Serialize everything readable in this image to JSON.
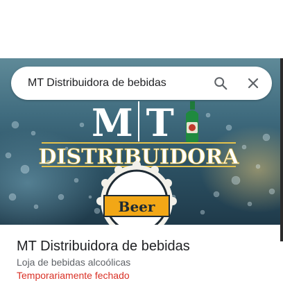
{
  "search": {
    "query": "MT Distribuidora de bebidas",
    "search_icon": "search-icon",
    "close_icon": "close-icon"
  },
  "hero": {
    "logo_monogram": "M T",
    "logo_wordmark": "DISTRIBUIDORA",
    "logo_badge": "Beer"
  },
  "place": {
    "title": "MT Distribuidora de bebidas",
    "category": "Loja de bebidas alcoólicas",
    "status": "Temporariamente fechado",
    "status_color": "#d93025"
  }
}
